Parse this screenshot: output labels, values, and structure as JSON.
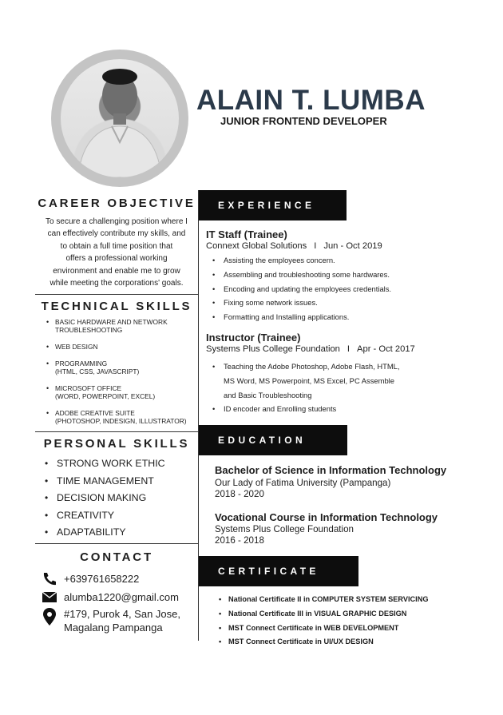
{
  "header": {
    "name": "ALAIN T. LUMBA",
    "role": "JUNIOR FRONTEND DEVELOPER"
  },
  "career_objective": {
    "title": "CAREER OBJECTIVE",
    "lines": [
      "To secure a challenging position where I",
      "can effectively contribute my skills, and",
      "to obtain a full time position that",
      "offers a professional working",
      "environment and enable me to grow",
      "while meeting the corporations' goals."
    ]
  },
  "technical_skills": {
    "title": "TECHNICAL SKILLS",
    "items": [
      {
        "main": "BASIC HARDWARE AND NETWORK",
        "sub": "TROUBLESHOOTING"
      },
      {
        "main": "WEB DESIGN",
        "sub": ""
      },
      {
        "main": "PROGRAMMING",
        "sub": "(HTML, CSS, JAVASCRIPT)"
      },
      {
        "main": "MICROSOFT OFFICE",
        "sub": "(WORD, POWERPOINT, EXCEL)"
      },
      {
        "main": "ADOBE CREATIVE SUITE",
        "sub": "(PHOTOSHOP, INDESIGN, ILLUSTRATOR)"
      }
    ]
  },
  "personal_skills": {
    "title": "PERSONAL SKILLS",
    "items": [
      "STRONG WORK ETHIC",
      "TIME MANAGEMENT",
      "DECISION MAKING",
      "CREATIVITY",
      "ADAPTABILITY"
    ]
  },
  "contact": {
    "title": "CONTACT",
    "phone": "+639761658222",
    "email": "alumba1220@gmail.com",
    "address_line1": "#179, Purok 4, San Jose,",
    "address_line2": "Magalang Pampanga",
    "icons": [
      "phone-icon",
      "mail-icon",
      "location-pin-icon"
    ]
  },
  "experience": {
    "title": "EXPERIENCE",
    "jobs": [
      {
        "title": "IT Staff  (Trainee)",
        "company": "Connext Global Solutions",
        "separator": "I",
        "period": "Jun - Oct 2019",
        "bullets": [
          "Assisting the employees concern.",
          "Assembling and troubleshooting some hardwares.",
          "Encoding and updating the employees credentials.",
          "Fixing some network issues.",
          "Formatting and Installing applications."
        ]
      },
      {
        "title": "Instructor (Trainee)",
        "company": "Systems Plus College Foundation",
        "separator": "I",
        "period": "Apr - Oct 2017",
        "bullets": [
          "Teaching the Adobe Photoshop, Adobe Flash, HTML,",
          "MS Word, MS Powerpoint, MS Excel, PC Assemble",
          "and Basic Troubleshooting",
          "ID encoder and Enrolling students"
        ]
      }
    ]
  },
  "education": {
    "title": "EDUCATION",
    "entries": [
      {
        "degree": "Bachelor of Science in Information Technology",
        "school": "Our Lady of Fatima University (Pampanga)",
        "years": "2018 - 2020"
      },
      {
        "degree": "Vocational Course in Information Technology",
        "school": "Systems Plus College Foundation",
        "years": "2016 - 2018"
      }
    ]
  },
  "certificate": {
    "title": "CERTIFICATE",
    "items": [
      "National Certificate II in COMPUTER SYSTEM SERVICING",
      "National Certificate III in VISUAL GRAPHIC DESIGN",
      "MST Connect Certificate in WEB DEVELOPMENT",
      "MST Connect Certificate in UI/UX DESIGN"
    ]
  },
  "colors": {
    "name": "#2b3a4a",
    "band": "#0d0d0d",
    "photo_ring": "#c4c4c4"
  }
}
